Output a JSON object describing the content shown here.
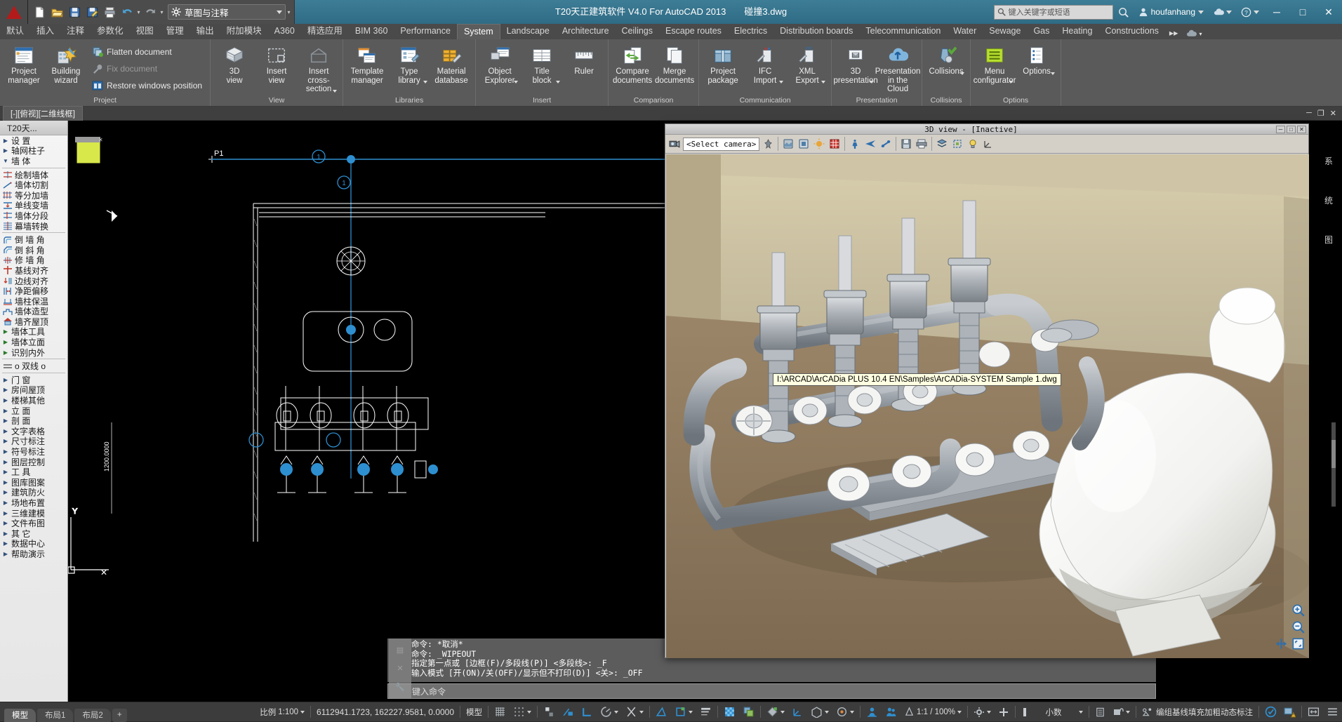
{
  "titlebar": {
    "app_icon": "autocad-a-icon",
    "quick_access": [
      {
        "name": "new-document-icon",
        "glyph": "new"
      },
      {
        "name": "open-document-icon",
        "glyph": "open"
      },
      {
        "name": "save-icon",
        "glyph": "save"
      },
      {
        "name": "save-as-icon",
        "glyph": "saveas"
      },
      {
        "name": "plot-icon",
        "glyph": "print"
      },
      {
        "name": "undo-icon",
        "glyph": "undo"
      },
      {
        "name": "redo-icon",
        "glyph": "redo"
      }
    ],
    "workspace": "草图与注释",
    "title": "T20天正建筑软件 V4.0 For AutoCAD 2013",
    "filename": "碰撞3.dwg",
    "search_placeholder": "键入关键字或短语",
    "user": "houfanhang",
    "window_buttons": {
      "minimize": "─",
      "maximize": "□",
      "close": "✕"
    }
  },
  "ribbon_tabs": [
    {
      "label": "默认",
      "active": false
    },
    {
      "label": "插入",
      "active": false
    },
    {
      "label": "注释",
      "active": false
    },
    {
      "label": "参数化",
      "active": false
    },
    {
      "label": "视图",
      "active": false
    },
    {
      "label": "管理",
      "active": false
    },
    {
      "label": "输出",
      "active": false
    },
    {
      "label": "附加模块",
      "active": false
    },
    {
      "label": "A360",
      "active": false
    },
    {
      "label": "精选应用",
      "active": false
    },
    {
      "label": "BIM 360",
      "active": false
    },
    {
      "label": "Performance",
      "active": false
    },
    {
      "label": "System",
      "active": true
    },
    {
      "label": "Landscape",
      "active": false
    },
    {
      "label": "Architecture",
      "active": false
    },
    {
      "label": "Ceilings",
      "active": false
    },
    {
      "label": "Escape routes",
      "active": false
    },
    {
      "label": "Electrics",
      "active": false
    },
    {
      "label": "Distribution boards",
      "active": false
    },
    {
      "label": "Telecommunication",
      "active": false
    },
    {
      "label": "Water",
      "active": false
    },
    {
      "label": "Sewage",
      "active": false
    },
    {
      "label": "Gas",
      "active": false
    },
    {
      "label": "Heating",
      "active": false
    },
    {
      "label": "Constructions",
      "active": false
    }
  ],
  "ribbon_panels": [
    {
      "title": "Project",
      "big_buttons": [
        {
          "label_line1": "Project",
          "label_line2": "manager",
          "icon": "project-manager-icon",
          "dropdown": false
        },
        {
          "label_line1": "Building",
          "label_line2": "wizard",
          "icon": "building-wizard-icon",
          "dropdown": false
        }
      ],
      "small_buttons": [
        {
          "label": "Flatten document",
          "icon": "flatten-document-icon",
          "disabled": false
        },
        {
          "label": "Fix document",
          "icon": "fix-document-icon",
          "disabled": true
        },
        {
          "label": "Restore windows position",
          "icon": "restore-windows-icon",
          "disabled": false
        }
      ]
    },
    {
      "title": "View",
      "big_buttons": [
        {
          "label_line1": "3D",
          "label_line2": "view",
          "icon": "3d-view-icon",
          "dropdown": false
        },
        {
          "label_line1": "Insert",
          "label_line2": "view",
          "icon": "insert-view-icon",
          "dropdown": false
        },
        {
          "label_line1": "Insert",
          "label_line2": "cross-section",
          "icon": "insert-cross-section-icon",
          "dropdown": true
        }
      ],
      "small_buttons": []
    },
    {
      "title": "Libraries",
      "big_buttons": [
        {
          "label_line1": "Template",
          "label_line2": "manager",
          "icon": "template-manager-icon",
          "dropdown": false
        },
        {
          "label_line1": "Type",
          "label_line2": "library",
          "icon": "type-library-icon",
          "dropdown": true
        },
        {
          "label_line1": "Material",
          "label_line2": "database",
          "icon": "material-database-icon",
          "dropdown": false
        }
      ],
      "small_buttons": []
    },
    {
      "title": "Insert",
      "big_buttons": [
        {
          "label_line1": "Object",
          "label_line2": "Explorer",
          "icon": "object-explorer-icon",
          "dropdown": true
        },
        {
          "label_line1": "Title",
          "label_line2": "block",
          "icon": "title-block-icon",
          "dropdown": true
        },
        {
          "label_line1": "Ruler",
          "label_line2": "",
          "icon": "ruler-icon",
          "dropdown": false
        }
      ],
      "small_buttons": []
    },
    {
      "title": "Comparison",
      "big_buttons": [
        {
          "label_line1": "Compare",
          "label_line2": "documents",
          "icon": "compare-documents-icon",
          "dropdown": false
        },
        {
          "label_line1": "Merge",
          "label_line2": "documents",
          "icon": "merge-documents-icon",
          "dropdown": false
        }
      ],
      "small_buttons": []
    },
    {
      "title": "Communication",
      "big_buttons": [
        {
          "label_line1": "Project",
          "label_line2": "package",
          "icon": "project-package-icon",
          "dropdown": false
        },
        {
          "label_line1": "IFC",
          "label_line2": "Import",
          "icon": "ifc-import-icon",
          "dropdown": true
        },
        {
          "label_line1": "XML",
          "label_line2": "Export",
          "icon": "xml-export-icon",
          "dropdown": true
        }
      ],
      "small_buttons": []
    },
    {
      "title": "Presentation",
      "big_buttons": [
        {
          "label_line1": "3D",
          "label_line2": "presentation",
          "icon": "3d-presentation-icon",
          "dropdown": true
        },
        {
          "label_line1": "Presentation",
          "label_line2": "in the Cloud",
          "icon": "cloud-presentation-icon",
          "dropdown": false
        }
      ],
      "small_buttons": []
    },
    {
      "title": "Collisions",
      "big_buttons": [
        {
          "label_line1": "Collisions",
          "label_line2": "",
          "icon": "collisions-icon",
          "dropdown": true
        }
      ],
      "small_buttons": []
    },
    {
      "title": "Options",
      "big_buttons": [
        {
          "label_line1": "Menu",
          "label_line2": "configurator",
          "icon": "menu-configurator-icon",
          "dropdown": true
        },
        {
          "label_line1": "Options",
          "label_line2": "",
          "icon": "options-icon",
          "dropdown": true
        }
      ],
      "small_buttons": []
    }
  ],
  "document_tab": "[-][俯视][二维线框]",
  "palette": {
    "header": "T20天...",
    "items": [
      {
        "label": "设    置",
        "kind": "arrow",
        "spaced": true
      },
      {
        "label": "轴网柱子",
        "kind": "arrow"
      },
      {
        "label": "墙    体",
        "kind": "arrow-down",
        "spaced": true
      },
      {
        "sep": true
      },
      {
        "label": "绘制墙体",
        "kind": "icon",
        "icon": "draw-wall-icon"
      },
      {
        "label": "墙体切割",
        "kind": "icon",
        "icon": "wall-cut-icon"
      },
      {
        "label": "等分加墙",
        "kind": "icon",
        "icon": "equal-wall-icon"
      },
      {
        "label": "单线变墙",
        "kind": "icon",
        "icon": "line-to-wall-icon"
      },
      {
        "label": "墙体分段",
        "kind": "icon",
        "icon": "wall-segment-icon"
      },
      {
        "label": "幕墙转换",
        "kind": "icon",
        "icon": "curtain-wall-icon"
      },
      {
        "sep": true
      },
      {
        "label": "倒 墙 角",
        "kind": "icon",
        "icon": "wall-fillet-icon"
      },
      {
        "label": "倒 斜 角",
        "kind": "icon",
        "icon": "wall-chamfer-icon"
      },
      {
        "label": "修 墙 角",
        "kind": "icon",
        "icon": "fix-wall-corner-icon"
      },
      {
        "label": "基线对齐",
        "kind": "icon",
        "icon": "baseline-align-icon"
      },
      {
        "label": "边线对齐",
        "kind": "icon",
        "icon": "edge-align-icon"
      },
      {
        "label": "净距偏移",
        "kind": "icon",
        "icon": "offset-icon"
      },
      {
        "label": "墙柱保温",
        "kind": "icon",
        "icon": "wall-insulation-icon"
      },
      {
        "label": "墙体造型",
        "kind": "icon",
        "icon": "wall-shape-icon"
      },
      {
        "label": "墙齐屋顶",
        "kind": "icon",
        "icon": "wall-roof-icon"
      },
      {
        "label": "墙体工具",
        "kind": "arrow-green"
      },
      {
        "label": "墙体立面",
        "kind": "arrow-green"
      },
      {
        "label": "识别内外",
        "kind": "arrow-green"
      },
      {
        "sep": true
      },
      {
        "label": "o 双线 o",
        "kind": "icon",
        "icon": "double-line-icon"
      },
      {
        "sep": true
      },
      {
        "label": "门    窗",
        "kind": "arrow",
        "spaced": true
      },
      {
        "label": "房间屋顶",
        "kind": "arrow"
      },
      {
        "label": "楼梯其他",
        "kind": "arrow"
      },
      {
        "label": "立    面",
        "kind": "arrow",
        "spaced": true
      },
      {
        "label": "剖    面",
        "kind": "arrow",
        "spaced": true
      },
      {
        "label": "文字表格",
        "kind": "arrow"
      },
      {
        "label": "尺寸标注",
        "kind": "arrow"
      },
      {
        "label": "符号标注",
        "kind": "arrow"
      },
      {
        "label": "图层控制",
        "kind": "arrow"
      },
      {
        "label": "工    具",
        "kind": "arrow",
        "spaced": true
      },
      {
        "label": "图库图案",
        "kind": "arrow"
      },
      {
        "label": "建筑防火",
        "kind": "arrow"
      },
      {
        "label": "场地布置",
        "kind": "arrow"
      },
      {
        "label": "三维建模",
        "kind": "arrow"
      },
      {
        "label": "文件布图",
        "kind": "arrow"
      },
      {
        "label": "其    它",
        "kind": "arrow",
        "spaced": true
      },
      {
        "label": "数据中心",
        "kind": "arrow"
      },
      {
        "label": "帮助演示",
        "kind": "arrow"
      }
    ]
  },
  "canvas": {
    "label_p1": "P1",
    "dim_text": "1200.0000",
    "ucs_x": "X",
    "ucs_y": "Y"
  },
  "command_line": {
    "lines": [
      "命令: *取消*",
      "命令: _WIPEOUT",
      "指定第一点或 [边框(F)/多段线(P)] <多段线>: _F",
      "输入模式 [开(ON)/关(OFF)/显示但不打印(D)] <关>: _OFF"
    ],
    "prompt_placeholder": "键入命令"
  },
  "view3d": {
    "title": "3D view - [Inactive]",
    "camera_selector": "<Select camera>",
    "tooltip_path": "I:\\ARCAD\\ArCADia PLUS 10.4 EN\\Samples\\ArCADia-SYSTEM Sample 1.dwg",
    "window_buttons": {
      "minimize": "─",
      "maximize": "□",
      "close": "✕"
    },
    "toolbar_icons": [
      "camera-select-icon",
      "pin-icon",
      "render-settings-icon",
      "render-region-icon",
      "sun-icon",
      "grid-icon",
      "walk-mode-icon",
      "fly-mode-icon",
      "orbit-icon",
      "save-view-icon",
      "print-view-icon",
      "layers-icon",
      "clip-icon",
      "lightbulb-icon",
      "3d-axes-icon"
    ],
    "zoom_controls": [
      "zoom-in-icon",
      "zoom-out-icon",
      "zoom-extents-icon",
      "pan-icon"
    ]
  },
  "statusbar": {
    "layout_tabs": [
      {
        "label": "模型",
        "active": true
      },
      {
        "label": "布局1",
        "active": false
      },
      {
        "label": "布局2",
        "active": false
      },
      {
        "label": "+",
        "active": false
      }
    ],
    "scale_label": "比例",
    "scale_value": "1:100",
    "coordinates": "6112941.1723, 162227.9581, 0.0000",
    "space_mode": "模型",
    "toggles": [
      "grid-display-icon",
      "snap-mode-icon",
      "ortho-icon",
      "polar-tracking-icon",
      "object-snap-icon",
      "3d-object-snap-icon",
      "otrack-icon",
      "dynamic-ucs-icon",
      "dyn-input-icon",
      "lineweight-icon",
      "transparency-icon",
      "selection-cycling-icon",
      "annotation-monitor-icon",
      "isometric-icon",
      "gizmo-icon"
    ],
    "annotation_scale": "1:1 / 100%",
    "units": "小数",
    "group_text": "编组基线填充加粗动态标注",
    "right_icons": [
      "clean-screen-icon",
      "customize-icon",
      "hardware-accel-icon",
      "fullscreen-icon",
      "menu-icon"
    ]
  }
}
